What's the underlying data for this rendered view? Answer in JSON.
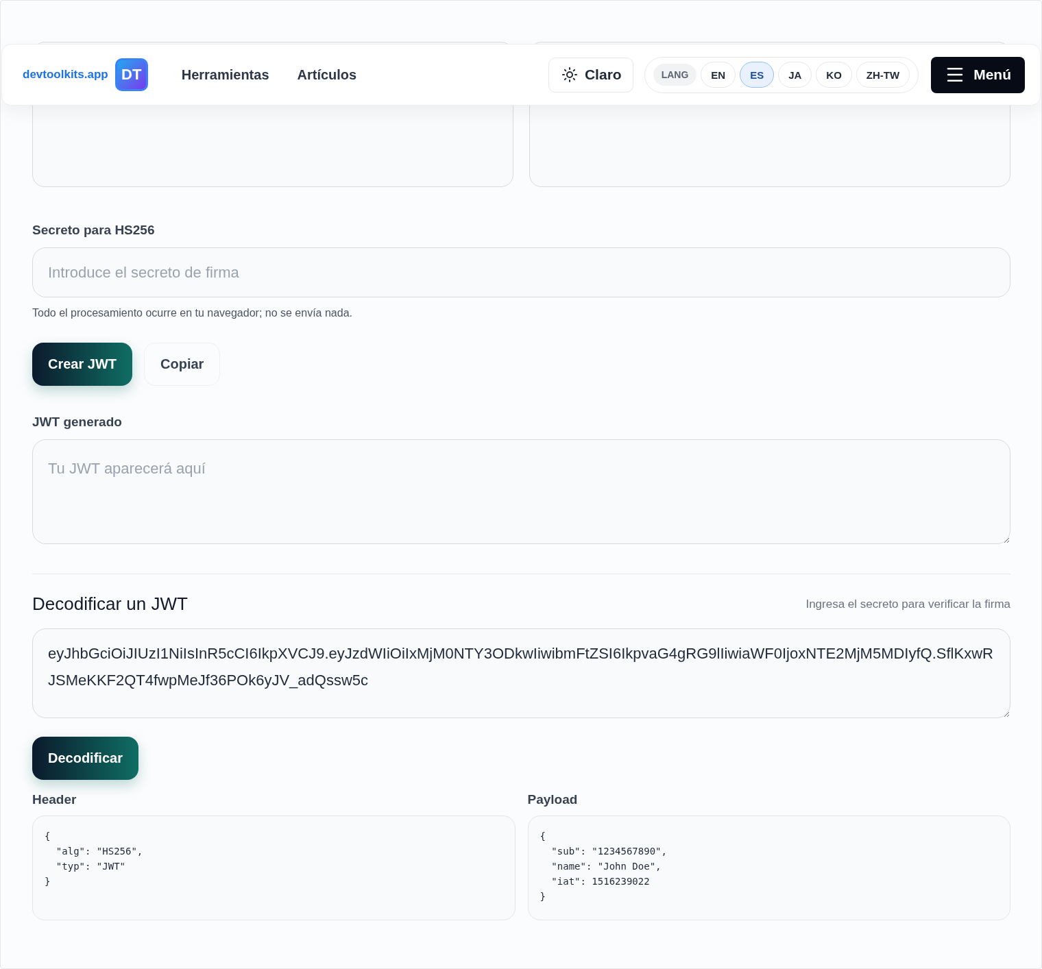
{
  "header": {
    "brand": "devtoolkits.app",
    "logo_mark": "DT",
    "nav": [
      "Herramientas",
      "Artículos"
    ],
    "theme_button": "Claro",
    "lang_label": "LANG",
    "languages": [
      {
        "label": "EN",
        "selected": false
      },
      {
        "label": "ES",
        "selected": true
      },
      {
        "label": "JA",
        "selected": false
      },
      {
        "label": "KO",
        "selected": false
      },
      {
        "label": "ZH-TW",
        "selected": false
      }
    ],
    "menu_button": "Menú"
  },
  "create": {
    "secret_label": "Secreto para HS256",
    "secret_placeholder": "Introduce el secreto de firma",
    "hint": "Todo el procesamiento ocurre en tu navegador; no se envía nada.",
    "buttons": [
      {
        "label": "Crear JWT",
        "kind": "primary"
      },
      {
        "label": "Copiar",
        "kind": "secondary"
      }
    ],
    "output_label": "JWT generado",
    "output_placeholder": "Tu JWT aparecerá aquí"
  },
  "decode": {
    "title": "Decodificar un JWT",
    "note": "Ingresa el secreto para verificar la firma",
    "token": "eyJhbGciOiJIUzI1NiIsInR5cCI6IkpXVCJ9.eyJzdWIiOiIxMjM0NTY3ODkwIiwibmFtZSI6IkpvaG4gRG9lIiwiaWF0IjoxNTE2MjM5MDIyfQ.SflKxwRJSMeKKF2QT4fwpMeJf36POk6yJV_adQssw5c",
    "button": "Decodificar",
    "panels": [
      {
        "label": "Header",
        "code": "{\n  \"alg\": \"HS256\",\n  \"typ\": \"JWT\"\n}"
      },
      {
        "label": "Payload",
        "code": "{\n  \"sub\": \"1234567890\",\n  \"name\": \"John Doe\",\n  \"iat\": 1516239022\n}"
      }
    ]
  }
}
